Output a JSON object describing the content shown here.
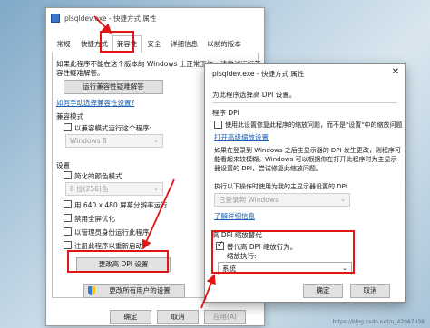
{
  "back_window": {
    "title": "plsqldev.exe - 快捷方式 属性",
    "tabs": [
      "常规",
      "快捷方式",
      "兼容性",
      "安全",
      "详细信息",
      "以前的版本"
    ],
    "intro_line1": "如果此程序不能在这个版本的 Windows 上正常工作，请尝试运行兼",
    "intro_line2": "容性疑难解答。",
    "troubleshoot_button": "运行兼容性疑难解答",
    "manual_link": "如何手动选择兼容性设置?",
    "compat_mode_label": "兼容模式",
    "compat_mode_checkbox": "以兼容模式运行这个程序:",
    "compat_mode_select": "Windows 8",
    "settings_label": "设置",
    "reduced_color_checkbox": "简化的颜色模式",
    "color_select": "8 位(256)色",
    "res_640_checkbox": "用 640 x 480 屏幕分辨率运行",
    "fullscreen_opt_checkbox": "禁用全屏优化",
    "admin_checkbox": "以管理员身份运行此程序",
    "register_restart_checkbox": "注册此程序以重新启动",
    "change_dpi_button": "更改高 DPI 设置",
    "change_all_users_button": "更改所有用户的设置",
    "ok_button": "确定",
    "cancel_button": "取消",
    "apply_button": "应用(A)"
  },
  "front_window": {
    "title": "plsqldev.exe - 快捷方式 属性",
    "choose_dpi": "为此程序选择高 DPI 设置。",
    "program_dpi_label": "程序 DPI",
    "program_dpi_checkbox": "使用此设置修复此程序的缩放问题，而不是\"设置\"中的缩放问题",
    "open_scaling_link": "打开高级缩放设置",
    "desc_line1": "如果在登录到 Windows 之后主显示器的 DPI 发生更改，则程序可",
    "desc_line2": "能看起来较模糊。Windows 可以根据你在打开此程序时为主显示",
    "desc_line3": "器设置的 DPI，尝试修复此缩放问题。",
    "use_dpi_label": "执行以下操作时使用为我的主显示器设置的 DPI",
    "use_dpi_select": "已登录到 Windows",
    "learn_more_link": "了解详细信息",
    "high_dpi_override_label": "高 DPI 缩放替代",
    "override_checkbox": "替代高 DPI 缩放行为。",
    "scaling_by_label": "缩放执行:",
    "scaling_select": "系统",
    "ok_button": "确定",
    "cancel_button": "取消"
  },
  "watermark": "https://blog.csdn.net/u_42087038",
  "colors": {
    "annotation_red": "#e01515",
    "link_blue": "#1a5fb4"
  }
}
